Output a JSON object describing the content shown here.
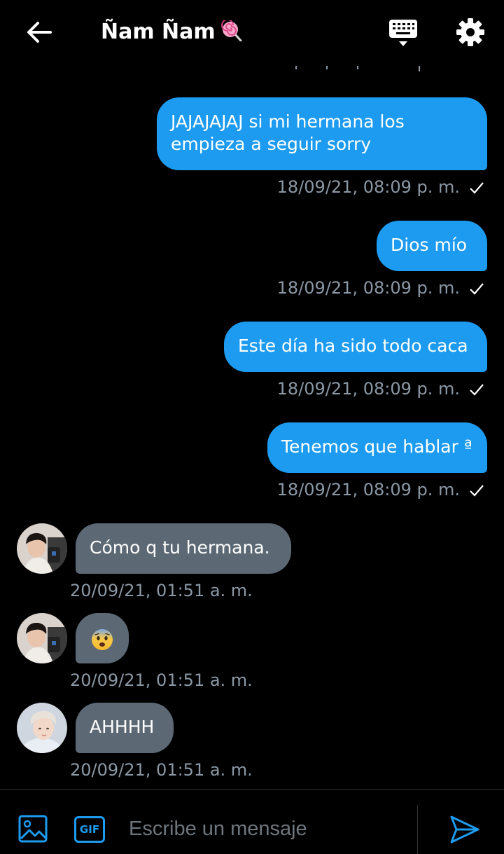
{
  "header": {
    "title": "Ñam Ñam",
    "title_emoji": "lollipop-icon",
    "back_icon": "arrow-left-icon",
    "keyboard_icon": "keyboard-icon",
    "settings_icon": "gear-icon"
  },
  "messages_out": [
    {
      "lines": [
        "JAJAJAJAJ si mi hermana los",
        "empieza a seguir sorry"
      ],
      "timestamp": "18/09/21, 08:09 p. m."
    },
    {
      "lines": [
        "Dios mío"
      ],
      "timestamp": "18/09/21, 08:09 p. m."
    },
    {
      "lines": [
        "Este día ha sido todo caca"
      ],
      "timestamp": "18/09/21, 08:09 p. m."
    },
    {
      "lines": [
        "Tenemos que hablar ª"
      ],
      "timestamp": "18/09/21, 08:09 p. m."
    }
  ],
  "messages_in": [
    {
      "text": "Cómo q tu hermana.",
      "timestamp": "20/09/21, 01:51 a. m."
    },
    {
      "text": "",
      "emoji": "anxious-face-icon",
      "timestamp": "20/09/21, 01:51 a. m."
    },
    {
      "text": "AHHHH",
      "timestamp": "20/09/21, 01:51 a. m."
    }
  ],
  "composer": {
    "placeholder": "Escribe un mensaje",
    "gif_label": "GIF",
    "image_icon": "image-icon",
    "send_icon": "send-icon"
  },
  "colors": {
    "background": "#000000",
    "outgoing_bubble": "#1d9bf0",
    "incoming_bubble": "#5c6975",
    "timestamp": "#8b98a5",
    "accent": "#1d9bf0"
  }
}
